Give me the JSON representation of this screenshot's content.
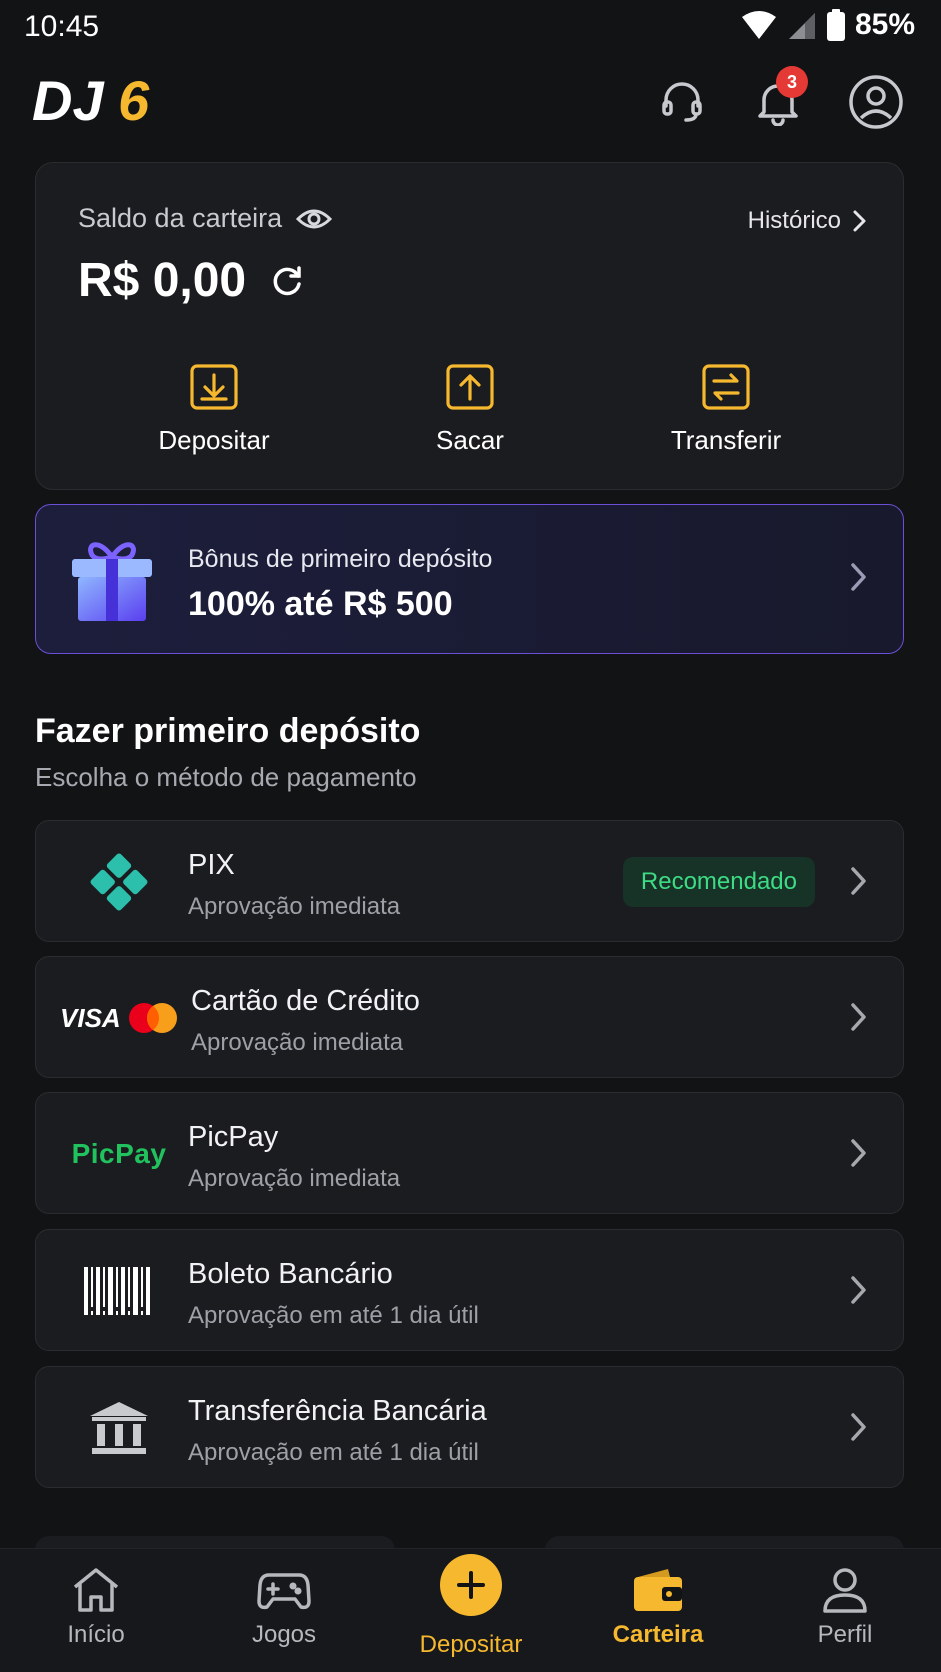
{
  "status_bar": {
    "time": "10:45",
    "battery": "85%"
  },
  "header": {
    "brand": "DJ6",
    "notification_count": "3"
  },
  "wallet": {
    "label": "Saldo da carteira",
    "history_label": "Histórico",
    "balance": "R$ 0,00",
    "actions": [
      {
        "label": "Depositar",
        "icon": "deposit-icon"
      },
      {
        "label": "Sacar",
        "icon": "withdraw-icon"
      },
      {
        "label": "Transferir",
        "icon": "transfer-icon"
      }
    ]
  },
  "bonus": {
    "subtitle": "Bônus de primeiro depósito",
    "title": "100% até R$ 500"
  },
  "section": {
    "title": "Fazer primeiro depósito",
    "subtitle": "Escolha o método de pagamento"
  },
  "payment_methods": [
    {
      "name": "PIX",
      "description": "Aprovação imediata",
      "badge": "Recomendado",
      "icon": "pix-icon"
    },
    {
      "name": "Cartão de Crédito",
      "description": "Aprovação imediata",
      "icon": "visa-mastercard-icon",
      "visa_text": "VISA"
    },
    {
      "name": "PicPay",
      "description": "Aprovação imediata",
      "icon": "picpay-logo",
      "logo_text": "PicPay"
    },
    {
      "name": "Boleto Bancário",
      "description": "Aprovação em até 1 dia útil",
      "icon": "barcode-icon"
    },
    {
      "name": "Transferência Bancária",
      "description": "Aprovação em até 1 dia útil",
      "icon": "bank-icon"
    }
  ],
  "bottom_nav": [
    {
      "label": "Início",
      "icon": "home-icon"
    },
    {
      "label": "Jogos",
      "icon": "gamepad-icon"
    },
    {
      "label": "Depositar",
      "icon": "plus-icon"
    },
    {
      "label": "Carteira",
      "icon": "wallet-icon",
      "active": true
    },
    {
      "label": "Perfil",
      "icon": "user-icon"
    }
  ],
  "colors": {
    "background": "#121315",
    "card": "#1b1c1f",
    "accent": "#f5b82e",
    "bonus_border": "#6b4fd6",
    "recommended_bg": "#173227",
    "recommended_text": "#3ddc84",
    "badge_red": "#e53935"
  }
}
